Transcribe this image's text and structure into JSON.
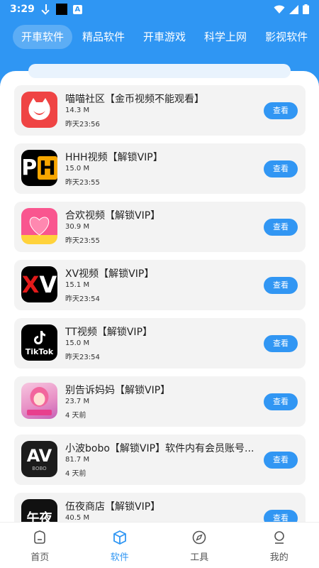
{
  "status": {
    "time": "3:29",
    "icons": [
      "download-icon",
      "app-icon",
      "text-a-icon",
      "wifi-icon",
      "signal-icon",
      "battery-icon"
    ]
  },
  "tabs": [
    {
      "label": "开車软件",
      "active": true
    },
    {
      "label": "精品软件",
      "active": false
    },
    {
      "label": "开車游戏",
      "active": false
    },
    {
      "label": "科学上网",
      "active": false
    },
    {
      "label": "影视软件",
      "active": false
    }
  ],
  "apps": [
    {
      "title": "喵喵社区【金币视频不能观看】",
      "size": "14.3 M",
      "date": "昨天23:56",
      "button": "查看",
      "icon": "miaomiao-icon"
    },
    {
      "title": "HHH视频【解锁VIP】",
      "size": "15.0 M",
      "date": "昨天23:55",
      "button": "查看",
      "icon": "ph-icon",
      "icon_text_1": "P",
      "icon_text_2": "H"
    },
    {
      "title": "合欢视频【解锁VIP】",
      "size": "30.9 M",
      "date": "昨天23:55",
      "button": "查看",
      "icon": "heart-icon"
    },
    {
      "title": "XV视频【解锁VIP】",
      "size": "15.1 M",
      "date": "昨天23:54",
      "button": "查看",
      "icon": "xv-icon",
      "icon_text_1": "X",
      "icon_text_2": "V"
    },
    {
      "title": "TT视频【解锁VIP】",
      "size": "15.0 M",
      "date": "昨天23:54",
      "button": "查看",
      "icon": "tiktok-icon",
      "icon_text_1": "TikTok"
    },
    {
      "title": "别告诉妈妈【解锁VIP】",
      "size": "23.7 M",
      "date": "4 天前",
      "button": "查看",
      "icon": "anime-girl-icon"
    },
    {
      "title": "小波bobo【解锁VIP】软件内有会员账号...",
      "size": "81.7 M",
      "date": "4 天前",
      "button": "查看",
      "icon": "av-icon",
      "icon_text_1": "AV",
      "icon_text_2": "BOBO"
    },
    {
      "title": "伍夜商店【解锁VIP】",
      "size": "40.5 M",
      "date": "",
      "button": "查看",
      "icon": "wuye-icon",
      "icon_text_1": "午夜"
    }
  ],
  "nav": [
    {
      "label": "首页",
      "icon": "home-icon",
      "active": false
    },
    {
      "label": "软件",
      "icon": "cube-icon",
      "active": true
    },
    {
      "label": "工具",
      "icon": "compass-icon",
      "active": false
    },
    {
      "label": "我的",
      "icon": "user-icon",
      "active": false
    }
  ],
  "colors": {
    "primary": "#2f96f3",
    "card": "#f3f3f3",
    "button": "#3196f3"
  }
}
